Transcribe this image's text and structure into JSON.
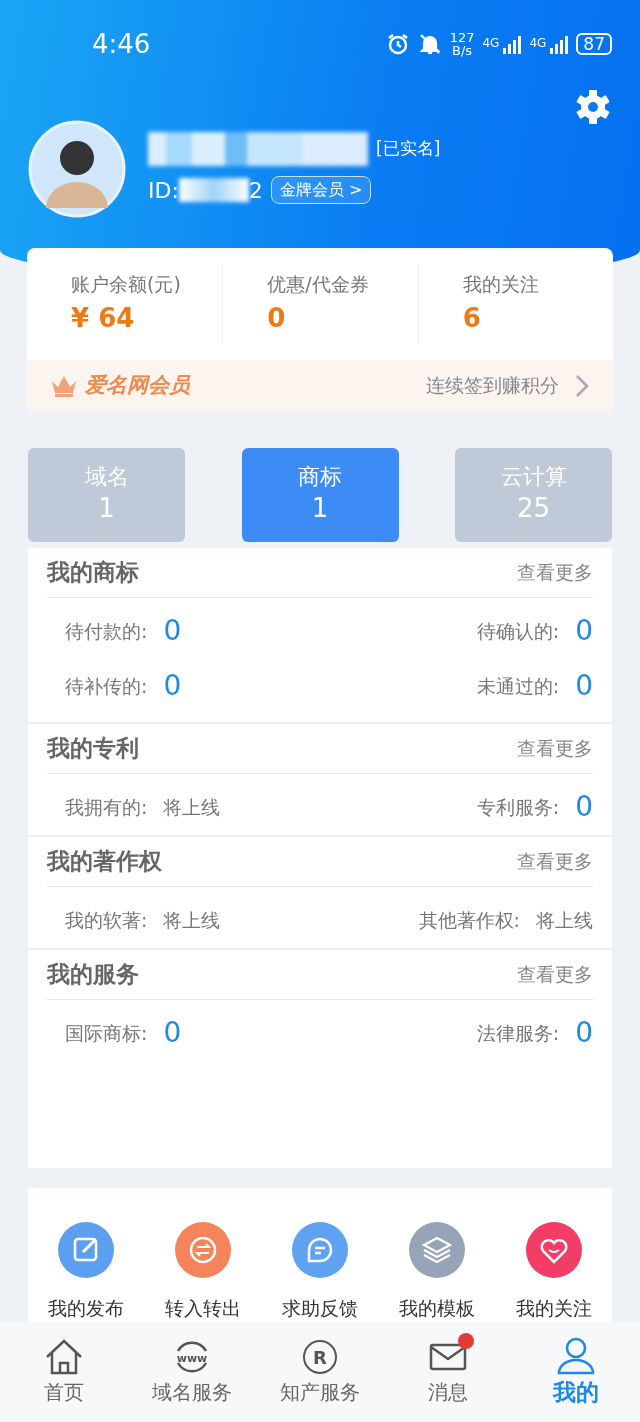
{
  "status_bar": {
    "time": "4:46",
    "speed": "127",
    "speed_unit": "B/s",
    "network_1": "4G",
    "network_2": "4G",
    "battery": "87"
  },
  "profile": {
    "verified": "[已实名]",
    "id_label": "ID:",
    "id_tail": "2",
    "member_badge": "金牌会员 >"
  },
  "stats": [
    {
      "label": "账户余额(元)",
      "value": "¥ 64"
    },
    {
      "label": "优惠/代金券",
      "value": "0"
    },
    {
      "label": "我的关注",
      "value": "6"
    }
  ],
  "membership": {
    "title": "爱名网会员",
    "link": "连续签到赚积分"
  },
  "tabs": [
    {
      "label": "域名",
      "count": "1",
      "selected": false
    },
    {
      "label": "商标",
      "count": "1",
      "selected": true
    },
    {
      "label": "云计算",
      "count": "25",
      "selected": false
    }
  ],
  "sections": [
    {
      "title": "我的商标",
      "more": "查看更多",
      "items": [
        {
          "label": "待付款的:",
          "value": "0",
          "kind": "count"
        },
        {
          "label": "待确认的:",
          "value": "0",
          "kind": "count"
        },
        {
          "label": "待补传的:",
          "value": "0",
          "kind": "count"
        },
        {
          "label": "未通过的:",
          "value": "0",
          "kind": "count"
        }
      ]
    },
    {
      "title": "我的专利",
      "more": "查看更多",
      "items": [
        {
          "label": "我拥有的:",
          "value": "将上线",
          "kind": "status"
        },
        {
          "label": "专利服务:",
          "value": "0",
          "kind": "count"
        }
      ]
    },
    {
      "title": "我的著作权",
      "more": "查看更多",
      "items": [
        {
          "label": "我的软著:",
          "value": "将上线",
          "kind": "status"
        },
        {
          "label": "其他著作权:",
          "value": "将上线",
          "kind": "status"
        }
      ]
    },
    {
      "title": "我的服务",
      "more": "查看更多",
      "items": [
        {
          "label": "国际商标:",
          "value": "0",
          "kind": "count"
        },
        {
          "label": "法律服务:",
          "value": "0",
          "kind": "count"
        }
      ]
    }
  ],
  "shortcuts": [
    {
      "label": "我的发布",
      "color": "#5c9ff0"
    },
    {
      "label": "转入转出",
      "color": "#f5845a"
    },
    {
      "label": "求助反馈",
      "color": "#5ea2f0"
    },
    {
      "label": "我的模板",
      "color": "#97a4b8"
    },
    {
      "label": "我的关注",
      "color": "#f23d66"
    }
  ],
  "bottom_nav": [
    {
      "label": "首页",
      "selected": false,
      "unread": false
    },
    {
      "label": "域名服务",
      "icon_text": "www",
      "selected": false,
      "unread": false
    },
    {
      "label": "知产服务",
      "icon_text": "R",
      "selected": false,
      "unread": false
    },
    {
      "label": "消息",
      "selected": false,
      "unread": true
    },
    {
      "label": "我的",
      "selected": true,
      "unread": false
    }
  ]
}
